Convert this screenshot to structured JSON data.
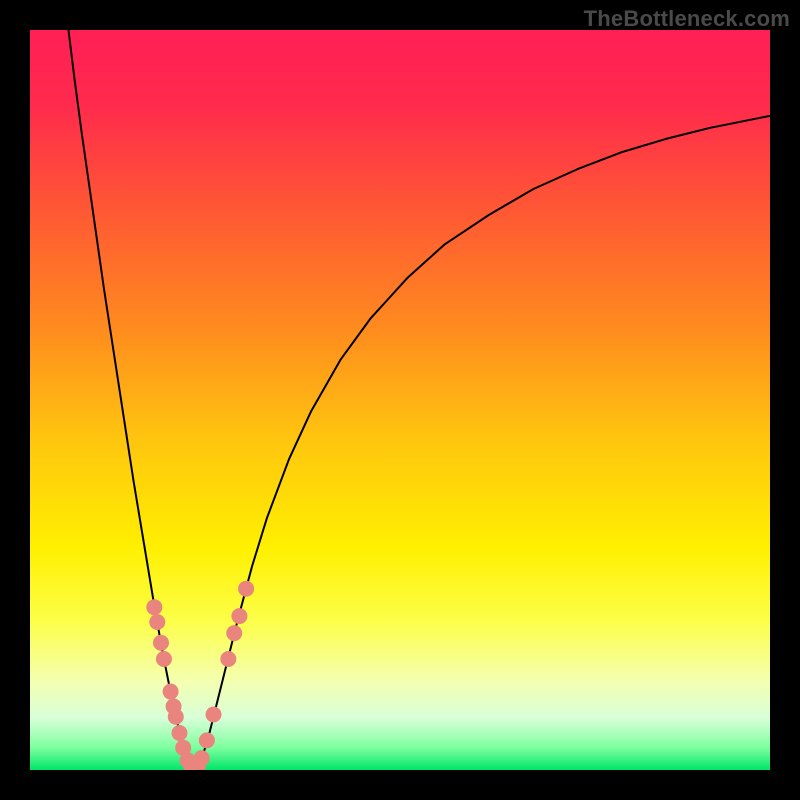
{
  "watermark": "TheBottleneck.com",
  "chart_data": {
    "type": "line",
    "title": "",
    "xlabel": "",
    "ylabel": "",
    "xlim": [
      0,
      1
    ],
    "ylim": [
      0,
      1
    ],
    "axes_visible": false,
    "background_gradient": {
      "stops": [
        {
          "offset": 0.0,
          "color": "#ff1f55"
        },
        {
          "offset": 0.1,
          "color": "#ff2a4d"
        },
        {
          "offset": 0.25,
          "color": "#ff5a33"
        },
        {
          "offset": 0.4,
          "color": "#ff8a1f"
        },
        {
          "offset": 0.55,
          "color": "#ffc40f"
        },
        {
          "offset": 0.7,
          "color": "#fff000"
        },
        {
          "offset": 0.8,
          "color": "#fcff4a"
        },
        {
          "offset": 0.88,
          "color": "#f4ffb0"
        },
        {
          "offset": 0.93,
          "color": "#d8ffd8"
        },
        {
          "offset": 0.97,
          "color": "#7dff9e"
        },
        {
          "offset": 1.0,
          "color": "#00e56a"
        }
      ]
    },
    "series": [
      {
        "name": "left-branch",
        "stroke": "#000000",
        "x": [
          0.052,
          0.06,
          0.07,
          0.08,
          0.09,
          0.1,
          0.11,
          0.12,
          0.13,
          0.14,
          0.15,
          0.16,
          0.17,
          0.18,
          0.19,
          0.2,
          0.205,
          0.21,
          0.215
        ],
        "y": [
          1.0,
          0.935,
          0.86,
          0.79,
          0.72,
          0.65,
          0.585,
          0.52,
          0.455,
          0.39,
          0.33,
          0.27,
          0.21,
          0.155,
          0.105,
          0.06,
          0.04,
          0.022,
          0.01
        ]
      },
      {
        "name": "right-branch",
        "stroke": "#000000",
        "x": [
          0.23,
          0.24,
          0.25,
          0.265,
          0.28,
          0.3,
          0.32,
          0.35,
          0.38,
          0.42,
          0.46,
          0.51,
          0.56,
          0.62,
          0.68,
          0.74,
          0.8,
          0.86,
          0.92,
          0.98,
          1.0
        ],
        "y": [
          0.01,
          0.04,
          0.08,
          0.14,
          0.2,
          0.275,
          0.34,
          0.42,
          0.485,
          0.555,
          0.61,
          0.665,
          0.71,
          0.75,
          0.785,
          0.812,
          0.835,
          0.853,
          0.868,
          0.88,
          0.884
        ]
      },
      {
        "name": "bottom-bridge",
        "stroke": "#000000",
        "x": [
          0.215,
          0.218,
          0.222,
          0.226,
          0.23
        ],
        "y": [
          0.01,
          0.004,
          0.002,
          0.004,
          0.01
        ]
      }
    ],
    "markers": {
      "color": "#e9857e",
      "radius": 8,
      "points": [
        {
          "x": 0.168,
          "y": 0.22
        },
        {
          "x": 0.172,
          "y": 0.2
        },
        {
          "x": 0.177,
          "y": 0.172
        },
        {
          "x": 0.181,
          "y": 0.15
        },
        {
          "x": 0.19,
          "y": 0.106
        },
        {
          "x": 0.194,
          "y": 0.086
        },
        {
          "x": 0.197,
          "y": 0.072
        },
        {
          "x": 0.202,
          "y": 0.05
        },
        {
          "x": 0.207,
          "y": 0.03
        },
        {
          "x": 0.213,
          "y": 0.013
        },
        {
          "x": 0.218,
          "y": 0.004
        },
        {
          "x": 0.222,
          "y": 0.002
        },
        {
          "x": 0.227,
          "y": 0.006
        },
        {
          "x": 0.232,
          "y": 0.016
        },
        {
          "x": 0.239,
          "y": 0.04
        },
        {
          "x": 0.248,
          "y": 0.075
        },
        {
          "x": 0.268,
          "y": 0.15
        },
        {
          "x": 0.276,
          "y": 0.185
        },
        {
          "x": 0.283,
          "y": 0.208
        },
        {
          "x": 0.292,
          "y": 0.245
        }
      ]
    }
  }
}
